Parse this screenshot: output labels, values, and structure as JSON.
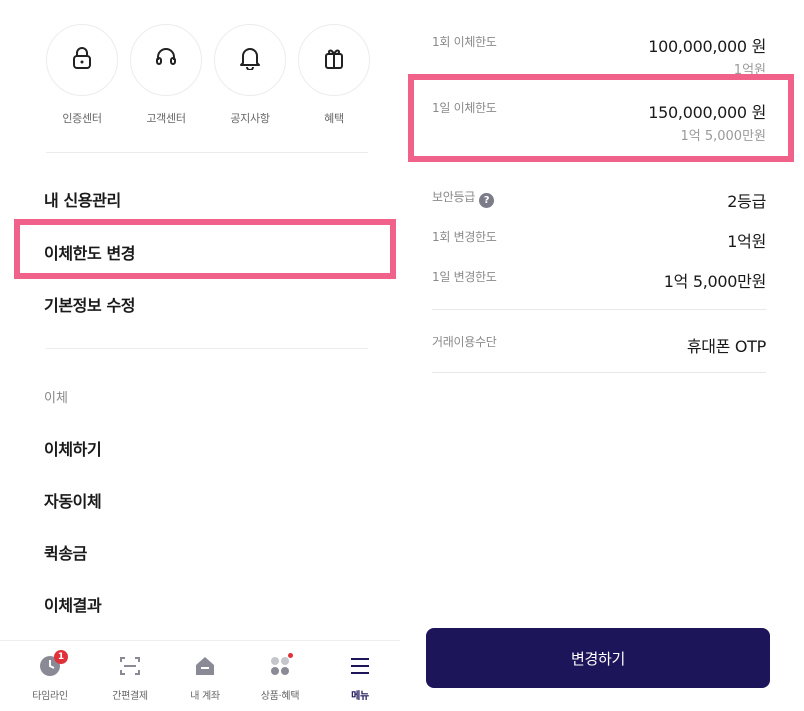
{
  "quick_menu": [
    {
      "label": "인증센터",
      "icon": "lock-icon"
    },
    {
      "label": "고객센터",
      "icon": "headset-icon"
    },
    {
      "label": "공지사항",
      "icon": "bell-icon"
    },
    {
      "label": "혜택",
      "icon": "gift-icon"
    }
  ],
  "menu": {
    "credit": "내 신용관리",
    "transfer_limit": "이체한도 변경",
    "basic_info": "기본정보 수정",
    "section_transfer": "이체",
    "transfer": "이체하기",
    "auto_transfer": "자동이체",
    "quick_send": "퀵송금",
    "transfer_result": "이체결과"
  },
  "bottom_nav": [
    {
      "label": "타임라인",
      "icon": "clock-icon",
      "badge": "1"
    },
    {
      "label": "간편결제",
      "icon": "scan-icon"
    },
    {
      "label": "내 계좌",
      "icon": "home-icon"
    },
    {
      "label": "상품·혜택",
      "icon": "apps-icon"
    },
    {
      "label": "메뉴",
      "icon": "hamburger-icon",
      "active": true
    }
  ],
  "limits": {
    "per_transfer": {
      "label": "1회 이체한도",
      "value": "100,000,000 원",
      "sub": "1억원"
    },
    "per_day": {
      "label": "1일 이체한도",
      "value": "150,000,000 원",
      "sub": "1억 5,000만원"
    },
    "security_grade": {
      "label": "보안등급",
      "value": "2등급"
    },
    "per_transfer_change": {
      "label": "1회 변경한도",
      "value": "1억원"
    },
    "per_day_change": {
      "label": "1일 변경한도",
      "value": "1억 5,000만원"
    },
    "method": {
      "label": "거래이용수단",
      "value": "휴대폰 OTP"
    }
  },
  "help_glyph": "?",
  "change_button": "변경하기",
  "colors": {
    "accent": "#1c1559",
    "highlight": "#f0628a",
    "badge": "#e0303a"
  }
}
